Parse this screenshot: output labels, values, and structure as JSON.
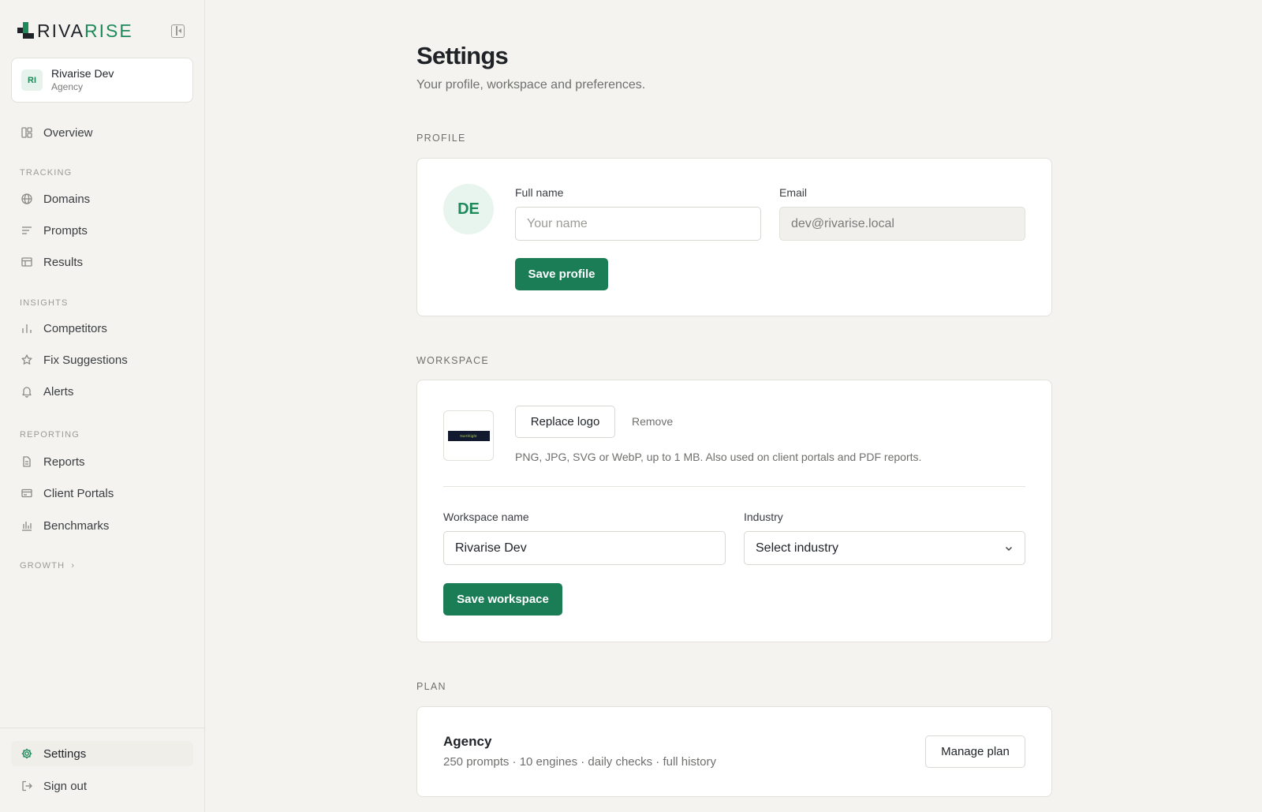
{
  "brand": {
    "name_dark": "RIVA",
    "name_accent": "RISE",
    "accent_color": "#1e8a5a"
  },
  "workspace_switcher": {
    "initials": "RI",
    "name": "Rivarise Dev",
    "plan": "Agency"
  },
  "nav": {
    "overview": "Overview",
    "tracking_label": "TRACKING",
    "tracking": [
      "Domains",
      "Prompts",
      "Results"
    ],
    "insights_label": "INSIGHTS",
    "insights": [
      "Competitors",
      "Fix Suggestions",
      "Alerts"
    ],
    "reporting_label": "REPORTING",
    "reporting": [
      "Reports",
      "Client Portals",
      "Benchmarks"
    ],
    "growth_label": "GROWTH",
    "settings": "Settings",
    "sign_out": "Sign out",
    "icons": [
      "layout-grid-icon",
      "globe-icon",
      "list-icon",
      "table-icon",
      "bar-chart-icon",
      "star-icon",
      "bell-icon",
      "file-icon",
      "browser-card-icon",
      "bar-chart-icon",
      "gear-icon",
      "sign-out-icon"
    ]
  },
  "page": {
    "title": "Settings",
    "subtitle": "Your profile, workspace and preferences."
  },
  "profile": {
    "section": "PROFILE",
    "avatar_initials": "DE",
    "full_name_label": "Full name",
    "full_name_value": "",
    "full_name_placeholder": "Your name",
    "email_label": "Email",
    "email_value": "dev@rivarise.local",
    "save_label": "Save profile"
  },
  "workspace": {
    "section": "WORKSPACE",
    "logo_text": "Northlight",
    "replace_logo_label": "Replace logo",
    "remove_label": "Remove",
    "logo_hint": "PNG, JPG, SVG or WebP, up to 1 MB. Also used on client portals and PDF reports.",
    "name_label": "Workspace name",
    "name_value": "Rivarise Dev",
    "industry_label": "Industry",
    "industry_value": "Select industry",
    "save_label": "Save workspace"
  },
  "plan": {
    "section": "PLAN",
    "name": "Agency",
    "description": "250 prompts · 10 engines · daily checks · full history",
    "manage_label": "Manage plan"
  },
  "colors": {
    "primary_button": "#1a7d55",
    "background": "#f4f3ef",
    "card": "#ffffff"
  }
}
